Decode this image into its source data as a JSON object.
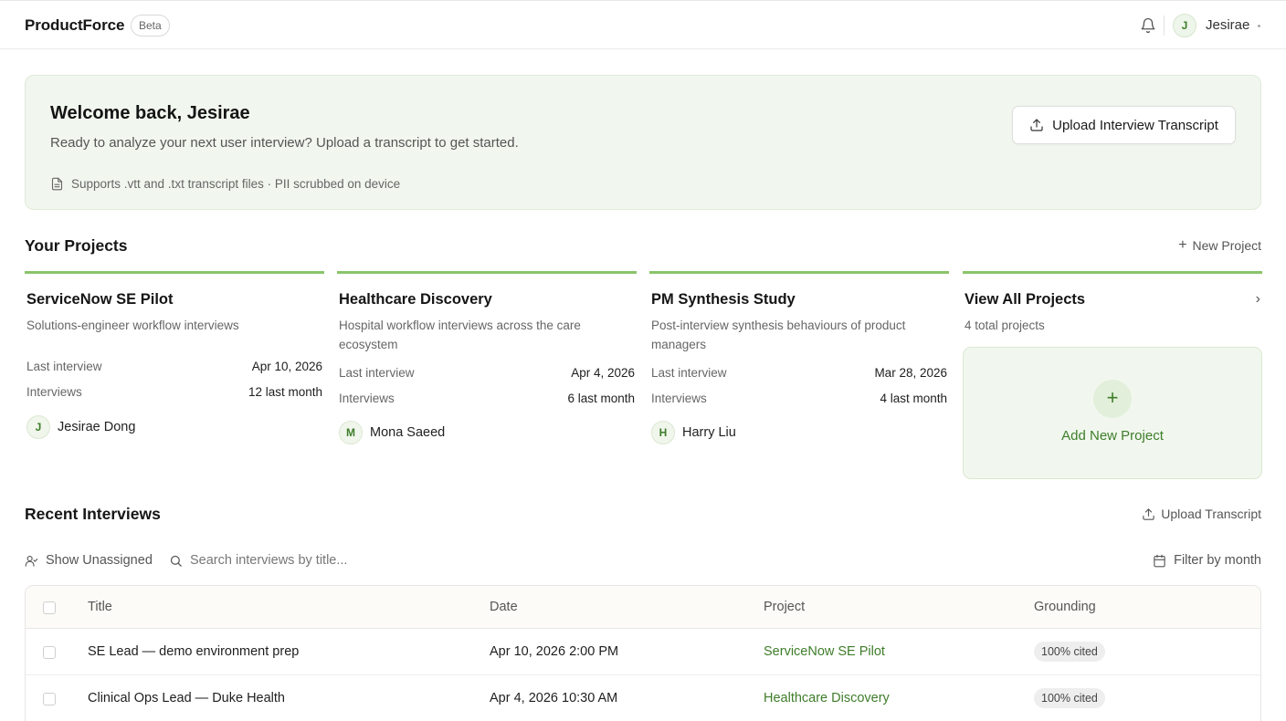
{
  "header": {
    "brand": "ProductForce",
    "badge": "Beta",
    "user_initial": "J",
    "user_name": "Jesirae"
  },
  "welcome": {
    "title": "Welcome back, Jesirae",
    "subtitle": "Ready to analyze your next user interview? Upload a transcript to get started.",
    "note": "Supports .vtt and .txt transcript files · PII scrubbed on device",
    "upload_label": "Upload Interview Transcript"
  },
  "projects_section": {
    "title": "Your Projects",
    "new_label": "New Project",
    "items": [
      {
        "name": "ServiceNow SE Pilot",
        "description": "Solutions-engineer workflow interviews",
        "last_interview_label": "Last interview",
        "last_interview": "Apr 10, 2026",
        "interviews_label": "Interviews",
        "interviews": "12 last month",
        "owner_initial": "J",
        "owner": "Jesirae Dong"
      },
      {
        "name": "Healthcare Discovery",
        "description": "Hospital workflow interviews across the care ecosystem",
        "last_interview_label": "Last interview",
        "last_interview": "Apr 4, 2026",
        "interviews_label": "Interviews",
        "interviews": "6 last month",
        "owner_initial": "M",
        "owner": "Mona Saeed"
      },
      {
        "name": "PM Synthesis Study",
        "description": "Post-interview synthesis behaviours of product managers",
        "last_interview_label": "Last interview",
        "last_interview": "Mar 28, 2026",
        "interviews_label": "Interviews",
        "interviews": "4 last month",
        "owner_initial": "H",
        "owner": "Harry Liu"
      }
    ],
    "view_all": {
      "title": "View All Projects",
      "count": "4 total projects",
      "add_label": "Add New Project"
    }
  },
  "interviews_section": {
    "title": "Recent Interviews",
    "upload_label": "Upload Transcript",
    "show_unassigned": "Show Unassigned",
    "search_placeholder": "Search interviews by title...",
    "filter_label": "Filter by month",
    "columns": {
      "title": "Title",
      "date": "Date",
      "project": "Project",
      "grounding": "Grounding"
    },
    "rows": [
      {
        "title": "SE Lead — demo environment prep",
        "date": "Apr 10, 2026 2:00 PM",
        "project": "ServiceNow SE Pilot",
        "grounding": "100% cited"
      },
      {
        "title": "Clinical Ops Lead — Duke Health",
        "date": "Apr 4, 2026 10:30 AM",
        "project": "Healthcare Discovery",
        "grounding": "100% cited"
      }
    ]
  },
  "colors": {
    "accent": "#3e7d2a",
    "accent_bar": "#8ac46a",
    "panel_bg": "#f1f7ee"
  }
}
